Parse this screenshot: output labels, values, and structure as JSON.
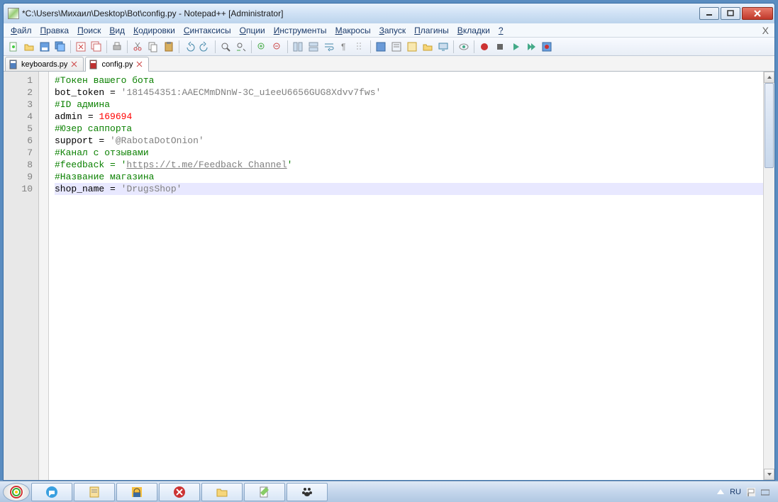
{
  "window": {
    "title": "*C:\\Users\\Михаил\\Desktop\\Bot\\config.py - Notepad++ [Administrator]"
  },
  "menus": [
    "Файл",
    "Правка",
    "Поиск",
    "Вид",
    "Кодировки",
    "Синтаксисы",
    "Опции",
    "Инструменты",
    "Макросы",
    "Запуск",
    "Плагины",
    "Вкладки",
    "?"
  ],
  "tabs": [
    {
      "label": "keyboards.py",
      "active": false,
      "modified": false
    },
    {
      "label": "config.py",
      "active": true,
      "modified": true
    }
  ],
  "code_lines": [
    {
      "n": 1,
      "segments": [
        {
          "t": "#Токен вашего бота",
          "c": "comment"
        }
      ]
    },
    {
      "n": 2,
      "segments": [
        {
          "t": "bot_token ",
          "c": "identifier"
        },
        {
          "t": "=",
          "c": "op"
        },
        {
          "t": " ",
          "c": "op"
        },
        {
          "t": "'181454351:AAECMmDNnW-3C_u1eeU6656GUG8Xdvv7fws'",
          "c": "string"
        }
      ]
    },
    {
      "n": 3,
      "segments": [
        {
          "t": "#ID админа",
          "c": "comment"
        }
      ]
    },
    {
      "n": 4,
      "segments": [
        {
          "t": "admin ",
          "c": "identifier"
        },
        {
          "t": "=",
          "c": "op"
        },
        {
          "t": " ",
          "c": "op"
        },
        {
          "t": "169694",
          "c": "number"
        }
      ]
    },
    {
      "n": 5,
      "segments": [
        {
          "t": "#Юзер саппорта",
          "c": "comment"
        }
      ]
    },
    {
      "n": 6,
      "segments": [
        {
          "t": "support ",
          "c": "identifier"
        },
        {
          "t": "=",
          "c": "op"
        },
        {
          "t": " ",
          "c": "op"
        },
        {
          "t": "'@RabotaDotOnion'",
          "c": "string"
        }
      ]
    },
    {
      "n": 7,
      "segments": [
        {
          "t": "#Канал с отзывами",
          "c": "comment"
        }
      ]
    },
    {
      "n": 8,
      "segments": [
        {
          "t": "#feedback = '",
          "c": "comment"
        },
        {
          "t": "https://t.me/Feedback_Channel",
          "c": "url"
        },
        {
          "t": "'",
          "c": "comment"
        }
      ]
    },
    {
      "n": 9,
      "segments": [
        {
          "t": "#Название магазина",
          "c": "comment"
        }
      ]
    },
    {
      "n": 10,
      "current": true,
      "segments": [
        {
          "t": "shop_name ",
          "c": "identifier"
        },
        {
          "t": "=",
          "c": "op"
        },
        {
          "t": " ",
          "c": "op"
        },
        {
          "t": "'DrugsShop'",
          "c": "string"
        }
      ]
    }
  ],
  "tray": {
    "lang": "RU"
  }
}
